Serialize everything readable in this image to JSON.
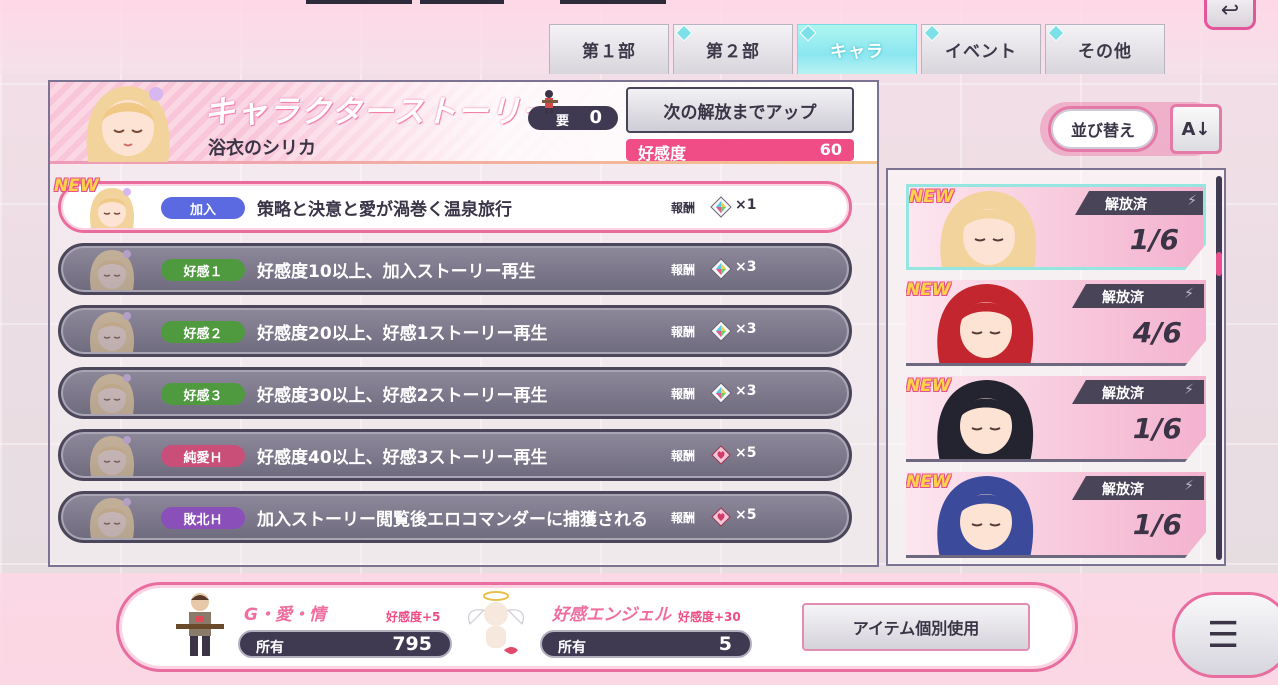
{
  "tabs": [
    {
      "label": "第１部"
    },
    {
      "label": "第２部"
    },
    {
      "label": "キャラ"
    },
    {
      "label": "イベント"
    },
    {
      "label": "その他"
    }
  ],
  "active_tab": "キャラ",
  "header": {
    "title": "キャラクターストーリー",
    "character_name": "浴衣のシリカ",
    "requirement_label": "要",
    "requirement_value": "0",
    "unlock_button": "次の解放までアップ",
    "affinity_label": "好感度",
    "affinity_value": "60"
  },
  "reward_label": "報酬",
  "new_label": "NEW",
  "stories": [
    {
      "badge": "加入",
      "badge_color": "#5b6ae0",
      "text": "策略と決意と愛が渦巻く温泉旅行",
      "multiplier": "×1",
      "gem": "rainbow"
    },
    {
      "badge": "好感１",
      "badge_color": "#4f9a3e",
      "text": "好感度10以上、加入ストーリー再生",
      "multiplier": "×3",
      "gem": "rainbow"
    },
    {
      "badge": "好感２",
      "badge_color": "#4f9a3e",
      "text": "好感度20以上、好感1ストーリー再生",
      "multiplier": "×3",
      "gem": "rainbow"
    },
    {
      "badge": "好感３",
      "badge_color": "#4f9a3e",
      "text": "好感度30以上、好感2ストーリー再生",
      "multiplier": "×3",
      "gem": "rainbow"
    },
    {
      "badge": "純愛Ｈ",
      "badge_color": "#c94f78",
      "text": "好感度40以上、好感3ストーリー再生",
      "multiplier": "×5",
      "gem": "heart"
    },
    {
      "badge": "敗北Ｈ",
      "badge_color": "#8a4fb8",
      "text": "加入ストーリー閲覧後エロコマンダーに捕獲される",
      "multiplier": "×5",
      "gem": "heart"
    }
  ],
  "sort_button": "並び替え",
  "sort_icon": "A↓",
  "characters": [
    {
      "status": "解放済",
      "progress": "1/6",
      "hair": "#f2d39b",
      "selected": true
    },
    {
      "status": "解放済",
      "progress": "4/6",
      "hair": "#c3262f",
      "selected": false
    },
    {
      "status": "解放済",
      "progress": "1/6",
      "hair": "#23242f",
      "selected": false
    },
    {
      "status": "解放済",
      "progress": "1/6",
      "hair": "#3c4a9c",
      "selected": false
    }
  ],
  "items": [
    {
      "name": "G・愛・情",
      "bonus": "好感度+5",
      "own_label": "所有",
      "own_value": "795"
    },
    {
      "name": "好感エンジェル",
      "bonus": "好感度+30",
      "own_label": "所有",
      "own_value": "5"
    }
  ],
  "use_item_button": "アイテム個別使用",
  "colors": {
    "accent_pink": "#e8508e",
    "accent_cyan": "#8be6f0",
    "dark": "#3f3a52"
  }
}
